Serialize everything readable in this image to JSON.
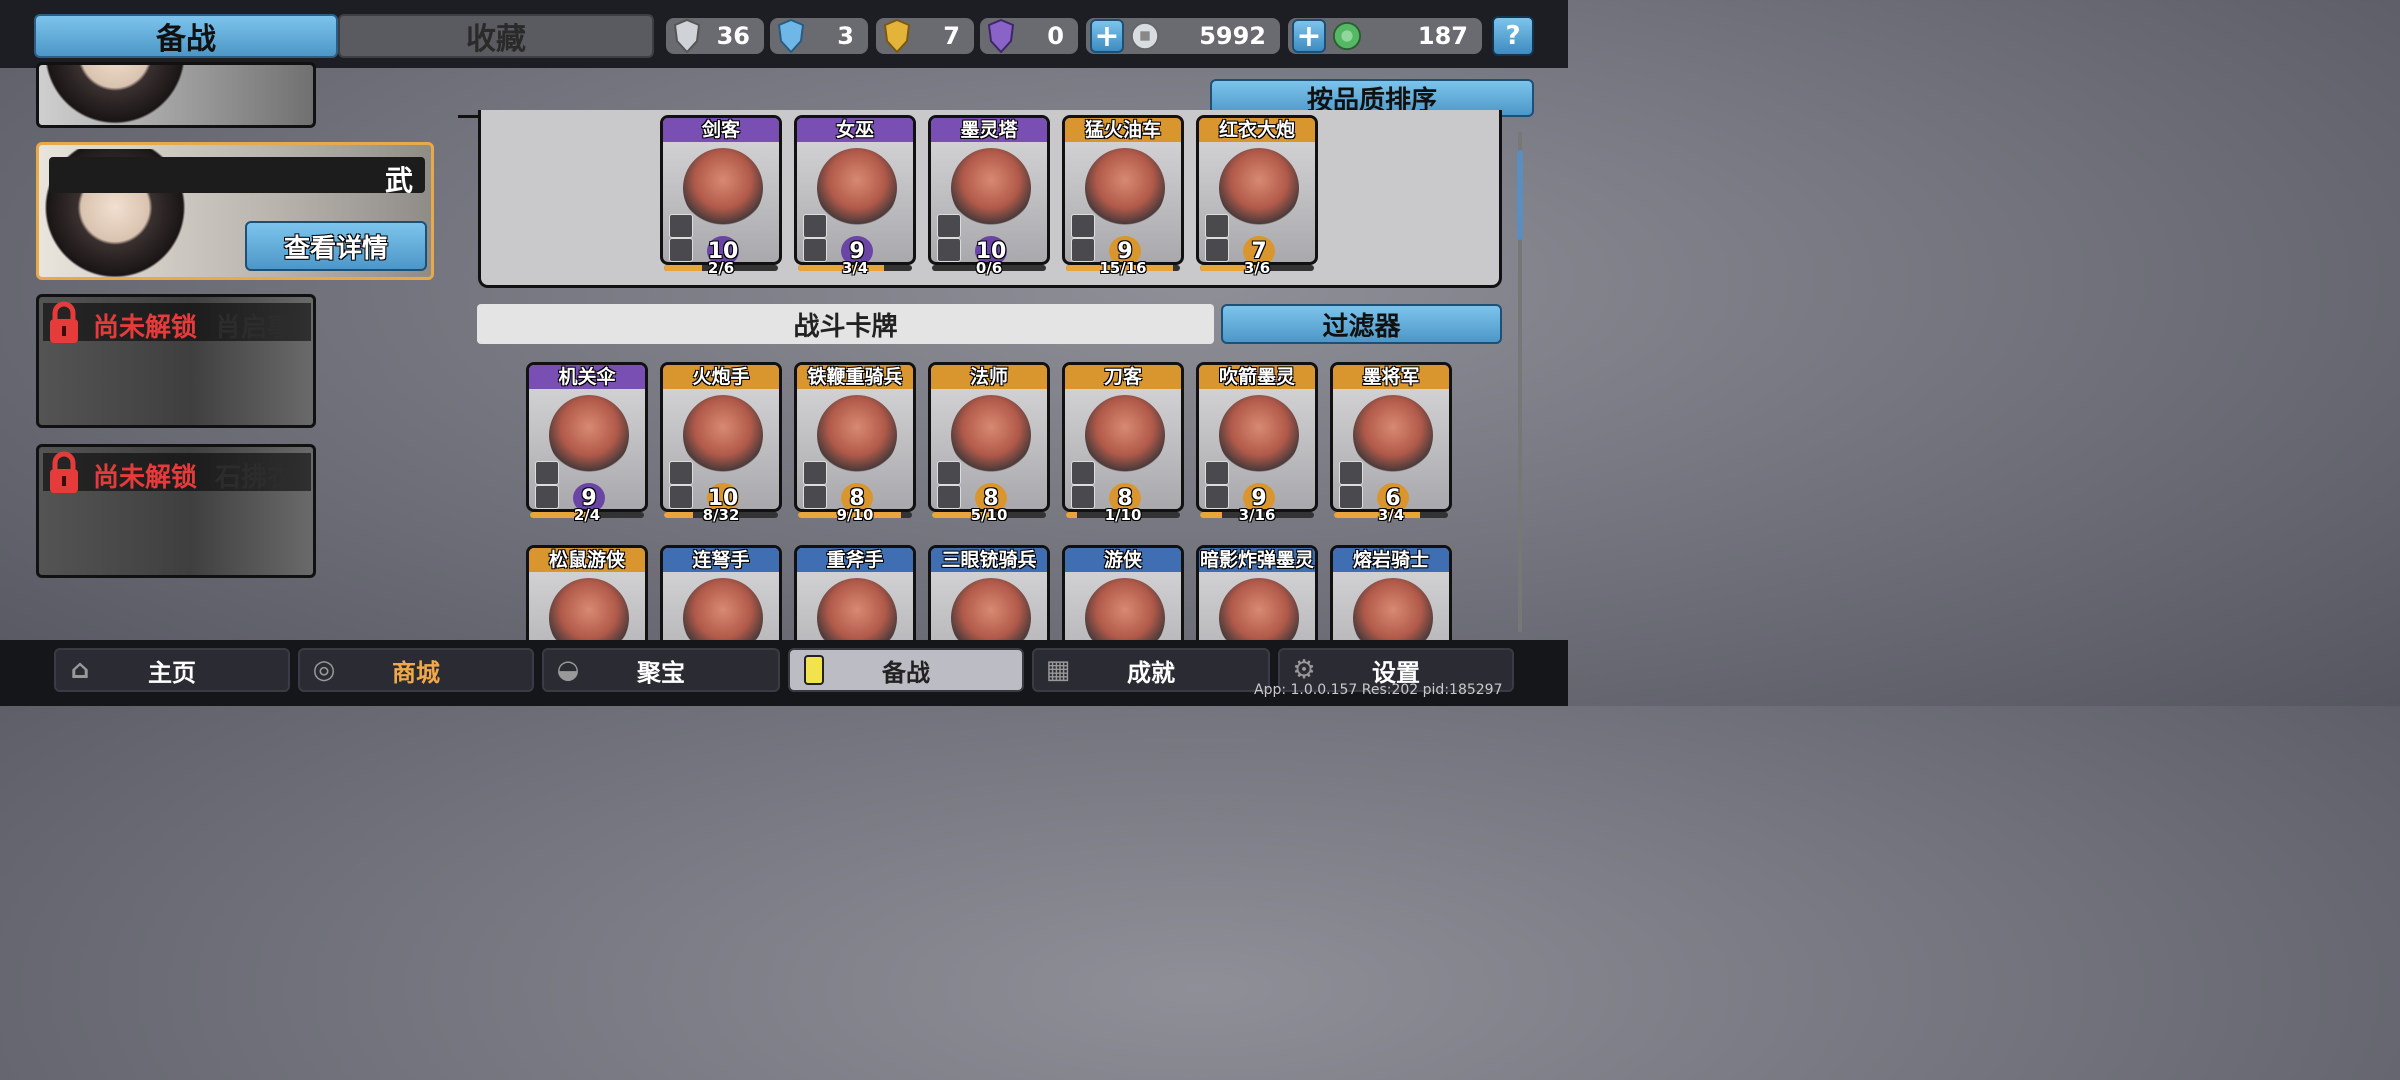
{
  "top_tabs": {
    "active": "备战",
    "inactive": "收藏"
  },
  "resources": [
    {
      "icon": "silver-shield-icon",
      "value": "36",
      "color": "#cfd3d8"
    },
    {
      "icon": "blue-crystal-shield-icon",
      "value": "3",
      "color": "#6fb7e6"
    },
    {
      "icon": "gold-shield-icon",
      "value": "7",
      "color": "#e3b33a"
    },
    {
      "icon": "purple-shield-icon",
      "value": "0",
      "color": "#8a63c9"
    },
    {
      "icon": "silver-coin-icon",
      "value": "5992",
      "color": "#d8dde2"
    },
    {
      "icon": "jade-coin-icon",
      "value": "187",
      "color": "#56b865"
    }
  ],
  "help_label": "?",
  "heroes": {
    "selected": {
      "tag": "武",
      "details_button": "查看详情"
    },
    "locked": [
      {
        "status": "尚未解锁",
        "name": "肖启事"
      },
      {
        "status": "尚未解锁",
        "name": "石拂衣"
      }
    ]
  },
  "sort_button": "按品质排序",
  "top_cards": [
    {
      "name": "剑客",
      "level": "10",
      "progress": "2/6",
      "rarity": "purple",
      "fill": 0.33
    },
    {
      "name": "女巫",
      "level": "9",
      "progress": "3/4",
      "rarity": "purple",
      "fill": 0.75
    },
    {
      "name": "墨灵塔",
      "level": "10",
      "progress": "0/6",
      "rarity": "purple",
      "fill": 0.0
    },
    {
      "name": "猛火油车",
      "level": "9",
      "progress": "15/16",
      "rarity": "gold",
      "fill": 0.94
    },
    {
      "name": "红衣大炮",
      "level": "7",
      "progress": "3/6",
      "rarity": "gold",
      "fill": 0.5
    }
  ],
  "section_title": "战斗卡牌",
  "filter_button": "过滤器",
  "battle_cards_row1": [
    {
      "name": "机关伞",
      "level": "9",
      "progress": "2/4",
      "rarity": "purple",
      "fill": 0.5
    },
    {
      "name": "火炮手",
      "level": "10",
      "progress": "8/32",
      "rarity": "gold",
      "fill": 0.25
    },
    {
      "name": "铁鞭重骑兵",
      "level": "8",
      "progress": "9/10",
      "rarity": "gold",
      "fill": 0.9
    },
    {
      "name": "法师",
      "level": "8",
      "progress": "5/10",
      "rarity": "gold",
      "fill": 0.5
    },
    {
      "name": "刀客",
      "level": "8",
      "progress": "1/10",
      "rarity": "gold",
      "fill": 0.1
    },
    {
      "name": "吹箭墨灵",
      "level": "9",
      "progress": "3/16",
      "rarity": "gold",
      "fill": 0.19
    },
    {
      "name": "墨将军",
      "level": "6",
      "progress": "3/4",
      "rarity": "gold",
      "fill": 0.75
    }
  ],
  "battle_cards_row2": [
    {
      "name": "松鼠游侠",
      "rarity": "gold"
    },
    {
      "name": "连弩手",
      "rarity": "blue"
    },
    {
      "name": "重斧手",
      "rarity": "blue"
    },
    {
      "name": "三眼铳骑兵",
      "rarity": "blue"
    },
    {
      "name": "游侠",
      "rarity": "blue"
    },
    {
      "name": "暗影炸弹墨灵",
      "rarity": "blue"
    },
    {
      "name": "熔岩骑士",
      "rarity": "blue"
    }
  ],
  "bottom_nav": [
    {
      "label": "主页",
      "icon": "temple-icon"
    },
    {
      "label": "商城",
      "icon": "coins-icon"
    },
    {
      "label": "聚宝",
      "icon": "treasure-bowl-icon"
    },
    {
      "label": "备战",
      "icon": "card-icon"
    },
    {
      "label": "成就",
      "icon": "grid-icon"
    },
    {
      "label": "设置",
      "icon": "gear-icon"
    }
  ],
  "app_info": "App: 1.0.0.157 Res:202 pid:185297"
}
